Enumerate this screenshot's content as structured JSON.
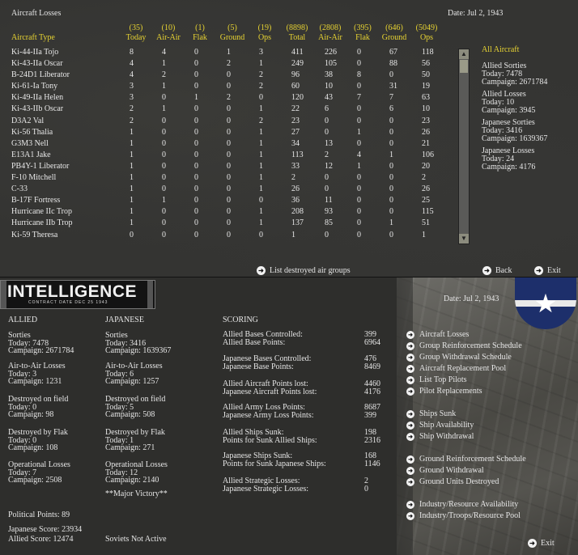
{
  "top": {
    "title": "Aircraft Losses",
    "date": "Date: Jul 2, 1943",
    "aircraft_type_header": "Aircraft Type",
    "columns": [
      {
        "total": "(35)",
        "label": "Today"
      },
      {
        "total": "(10)",
        "label": "Air-Air"
      },
      {
        "total": "(1)",
        "label": "Flak"
      },
      {
        "total": "(5)",
        "label": "Ground"
      },
      {
        "total": "(19)",
        "label": "Ops"
      },
      {
        "total": "(8898)",
        "label": "Total"
      },
      {
        "total": "(2808)",
        "label": "Air-Air"
      },
      {
        "total": "(395)",
        "label": "Flak"
      },
      {
        "total": "(646)",
        "label": "Ground"
      },
      {
        "total": "(5049)",
        "label": "Ops"
      }
    ],
    "rows": [
      [
        "Ki-44-IIa Tojo",
        "8",
        "4",
        "0",
        "1",
        "3",
        "411",
        "226",
        "0",
        "67",
        "118"
      ],
      [
        "Ki-43-IIa Oscar",
        "4",
        "1",
        "0",
        "2",
        "1",
        "249",
        "105",
        "0",
        "88",
        "56"
      ],
      [
        "B-24D1 Liberator",
        "4",
        "2",
        "0",
        "0",
        "2",
        "96",
        "38",
        "8",
        "0",
        "50"
      ],
      [
        "Ki-61-Ia Tony",
        "3",
        "1",
        "0",
        "0",
        "2",
        "60",
        "10",
        "0",
        "31",
        "19"
      ],
      [
        "Ki-49-IIa Helen",
        "3",
        "0",
        "1",
        "2",
        "0",
        "120",
        "43",
        "7",
        "7",
        "63"
      ],
      [
        "Ki-43-IIb Oscar",
        "2",
        "1",
        "0",
        "0",
        "1",
        "22",
        "6",
        "0",
        "6",
        "10"
      ],
      [
        "D3A2 Val",
        "2",
        "0",
        "0",
        "0",
        "2",
        "23",
        "0",
        "0",
        "0",
        "23"
      ],
      [
        "Ki-56 Thalia",
        "1",
        "0",
        "0",
        "0",
        "1",
        "27",
        "0",
        "1",
        "0",
        "26"
      ],
      [
        "G3M3 Nell",
        "1",
        "0",
        "0",
        "0",
        "1",
        "34",
        "13",
        "0",
        "0",
        "21"
      ],
      [
        "E13A1 Jake",
        "1",
        "0",
        "0",
        "0",
        "1",
        "113",
        "2",
        "4",
        "1",
        "106"
      ],
      [
        "PB4Y-1 Liberator",
        "1",
        "0",
        "0",
        "0",
        "1",
        "33",
        "12",
        "1",
        "0",
        "20"
      ],
      [
        "F-10 Mitchell",
        "1",
        "0",
        "0",
        "0",
        "1",
        "2",
        "0",
        "0",
        "0",
        "2"
      ],
      [
        "C-33",
        "1",
        "0",
        "0",
        "0",
        "1",
        "26",
        "0",
        "0",
        "0",
        "26"
      ],
      [
        "B-17F Fortress",
        "1",
        "1",
        "0",
        "0",
        "0",
        "36",
        "11",
        "0",
        "0",
        "25"
      ],
      [
        "Hurricane IIc Trop",
        "1",
        "0",
        "0",
        "0",
        "1",
        "208",
        "93",
        "0",
        "0",
        "115"
      ],
      [
        "Hurricane IIb Trop",
        "1",
        "0",
        "0",
        "0",
        "1",
        "137",
        "85",
        "0",
        "1",
        "51"
      ],
      [
        "Ki-59 Theresa",
        "0",
        "0",
        "0",
        "0",
        "0",
        "1",
        "0",
        "0",
        "0",
        "1"
      ]
    ],
    "side": {
      "filter": "All Aircraft",
      "allied_sorties": {
        "title": "Allied Sorties",
        "today": "Today:   7478",
        "campaign": "Campaign: 2671784"
      },
      "allied_losses": {
        "title": "Allied Losses",
        "today": "Today:   10",
        "campaign": "Campaign: 3945"
      },
      "japanese_sorties": {
        "title": "Japanese Sorties",
        "today": "Today:   3416",
        "campaign": "Campaign: 1639367"
      },
      "japanese_losses": {
        "title": "Japanese Losses",
        "today": "Today:   24",
        "campaign": "Campaign: 4176"
      }
    },
    "list_destroyed": "List destroyed air groups",
    "back": "Back",
    "exit": "Exit"
  },
  "bottom": {
    "logo_title": "INTELLIGENCE",
    "logo_sub": "CONTRACT DATE DEC 25 1943",
    "date": "Date: Jul 2, 1943",
    "allied_header": "ALLIED",
    "japanese_header": "JAPANESE",
    "scoring_header": "SCORING",
    "allied": {
      "sorties": [
        "Sorties",
        "Today:     7478",
        "Campaign: 2671784"
      ],
      "a2a": [
        "Air-to-Air Losses",
        "Today:     3",
        "Campaign: 1231"
      ],
      "field": [
        "Destroyed on field",
        "Today:     0",
        "Campaign: 98"
      ],
      "flak": [
        "Destroyed by Flak",
        "Today:     0",
        "Campaign: 108"
      ],
      "ops": [
        "Operational Losses",
        "Today:     7",
        "Campaign: 2508"
      ],
      "political": "Political Points: 89",
      "jap_score": "Japanese Score: 23934",
      "allied_score": "Allied Score: 12474"
    },
    "japanese": {
      "sorties": [
        "Sorties",
        "Today:     3416",
        "Campaign: 1639367"
      ],
      "a2a": [
        "Air-to-Air Losses",
        "Today:     6",
        "Campaign: 1257"
      ],
      "field": [
        "Destroyed on field",
        "Today:     5",
        "Campaign: 508"
      ],
      "flak": [
        "Destroyed by Flak",
        "Today:     1",
        "Campaign: 271"
      ],
      "ops": [
        "Operational Losses",
        "Today:     12",
        "Campaign: 2140"
      ],
      "victory": "**Major Victory**",
      "soviets": "Soviets Not Active"
    },
    "scoring": [
      [
        "Allied Bases Controlled:",
        "399"
      ],
      [
        "Allied Base Points:",
        "6964"
      ],
      [
        "Japanese Bases Controlled:",
        "476"
      ],
      [
        "Japanese Base Points:",
        "8469"
      ],
      [
        "Allied Aircraft Points lost:",
        "4460"
      ],
      [
        "Japanese Aircraft Points lost:",
        "4176"
      ],
      [
        "Allied Army Loss Points:",
        "8687"
      ],
      [
        "Japanese Army Loss Points:",
        "399"
      ],
      [
        "Allied Ships Sunk:",
        "198"
      ],
      [
        "Points for Sunk Allied Ships:",
        "2316"
      ],
      [
        "Japanese Ships Sunk:",
        "168"
      ],
      [
        "Points for Sunk Japanese Ships:",
        "1146"
      ],
      [
        "Allied Strategic Losses:",
        "2"
      ],
      [
        "Japanese Strategic Losses:",
        "0"
      ]
    ],
    "menu": [
      "Aircraft Losses",
      "Group Reinforcement Schedule",
      "Group Withdrawal Schedule",
      "Aircraft Replacement Pool",
      "List Top Pilots",
      "Pilot Replacements",
      "Ships Sunk",
      "Ship Availability",
      "Ship Withdrawal",
      "Ground Reinforcement Schedule",
      "Ground Withdrawal",
      "Ground Units Destroyed",
      "Industry/Resource Availability",
      "Industry/Troops/Resource Pool"
    ],
    "exit": "Exit"
  }
}
